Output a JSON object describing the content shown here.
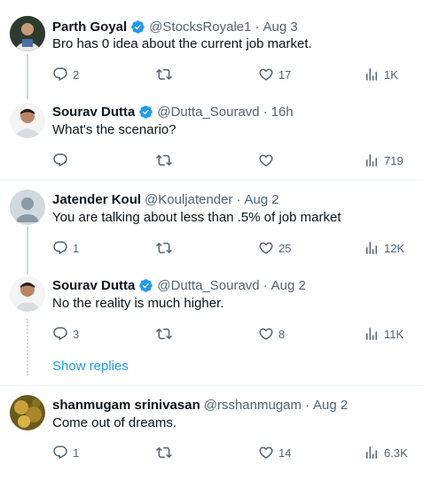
{
  "tweets": [
    {
      "name": "Parth Goyal",
      "verified": true,
      "handle": "@StocksRoyale1",
      "time": "Aug 3",
      "text": "Bro has 0 idea about the current job market.",
      "replies": "2",
      "retweets": "",
      "likes": "17",
      "views": "1K"
    },
    {
      "name": "Sourav Dutta",
      "verified": true,
      "handle": "@Dutta_Souravd",
      "time": "16h",
      "text": "What's the scenario?",
      "replies": "",
      "retweets": "",
      "likes": "",
      "views": "719"
    },
    {
      "name": "Jatender Koul",
      "verified": false,
      "handle": "@Kouljatender",
      "time": "Aug 2",
      "text": "You are talking about less than .5% of job market",
      "replies": "1",
      "retweets": "",
      "likes": "25",
      "views": "12K"
    },
    {
      "name": "Sourav Dutta",
      "verified": true,
      "handle": "@Dutta_Souravd",
      "time": "Aug 2",
      "text": "No the reality is much higher.",
      "replies": "3",
      "retweets": "",
      "likes": "8",
      "views": "11K"
    },
    {
      "name": "shanmugam srinivasan",
      "verified": false,
      "handle": "@rsshanmugam",
      "time": "Aug 2",
      "text": "Come out of dreams.",
      "replies": "1",
      "retweets": "",
      "likes": "14",
      "views": "6.3K"
    }
  ],
  "show_replies_label": "Show replies",
  "separator_dot": "·",
  "colors": {
    "text": "#0f1419",
    "secondary": "#536471",
    "accent": "#1d9bf0",
    "thread_line": "#cfd9de",
    "separator": "#eff3f4"
  },
  "icons": {
    "reply": "reply-icon",
    "retweet": "retweet-icon",
    "like": "like-icon",
    "views": "views-icon",
    "verified": "verified-badge-icon"
  }
}
